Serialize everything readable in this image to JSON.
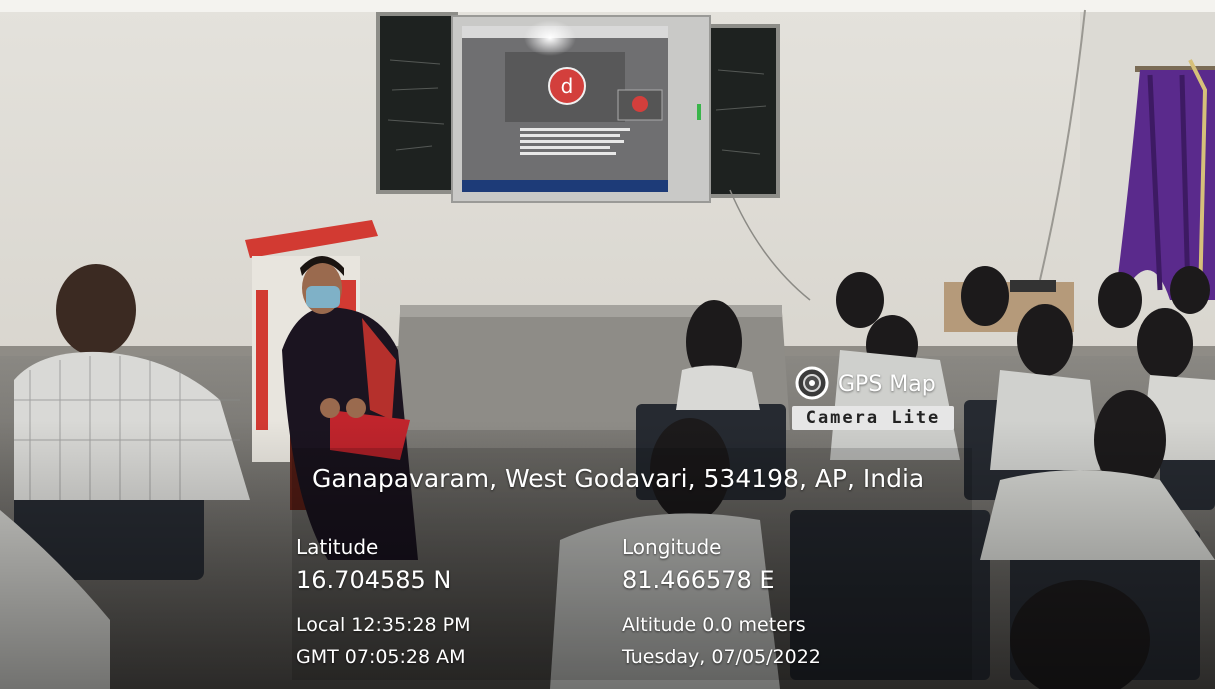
{
  "photo": {
    "description_icon": "gps-map-camera-logo-icon"
  },
  "logo": {
    "line1": "GPS Map",
    "line2": "Camera Lite"
  },
  "location": {
    "address": "Ganapavaram, West Godavari, 534198, AP, India",
    "latitude_label": "Latitude",
    "latitude_value": "16.704585 N",
    "longitude_label": "Longitude",
    "longitude_value": "81.466578 E",
    "local_time": "Local 12:35:28 PM",
    "gmt_time": "GMT 07:05:28 AM",
    "altitude": "Altitude  0.0 meters",
    "date": "Tuesday, 07/05/2022"
  },
  "colors": {
    "wall": "#e9e7e2",
    "floor": "#6e6c68",
    "podium_red": "#d23a32",
    "saree": "#1b1420",
    "curtain": "#5a2a8c",
    "screen": "#6f6f71",
    "overlay_text": "#ffffff"
  }
}
